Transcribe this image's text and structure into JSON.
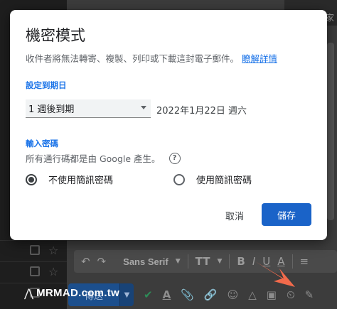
{
  "dialog": {
    "title": "機密模式",
    "description": "收件者將無法轉寄、複製、列印或下載這封電子郵件。",
    "learn_more": "瞭解詳情",
    "expiry_label": "設定到期日",
    "expiry_value": "1 週後到期",
    "expiry_date": "2022年1月22日 週六",
    "passcode_label": "輸入密碼",
    "passcode_note": "所有通行碼都是由 Google 產生。",
    "passcode_options": [
      {
        "label": "不使用簡訊密碼",
        "selected": true
      },
      {
        "label": "使用簡訊密碼",
        "selected": false
      }
    ],
    "cancel_label": "取消",
    "save_label": "儲存"
  },
  "background": {
    "top_corner_text": "家",
    "font_name": "Sans Serif",
    "send_label": "傳送"
  },
  "watermark": {
    "text": "MRMAD.com.tw"
  },
  "colors": {
    "accent": "#1a73e8",
    "save_button": "#1a63c8",
    "arrow": "#f26a4b"
  }
}
